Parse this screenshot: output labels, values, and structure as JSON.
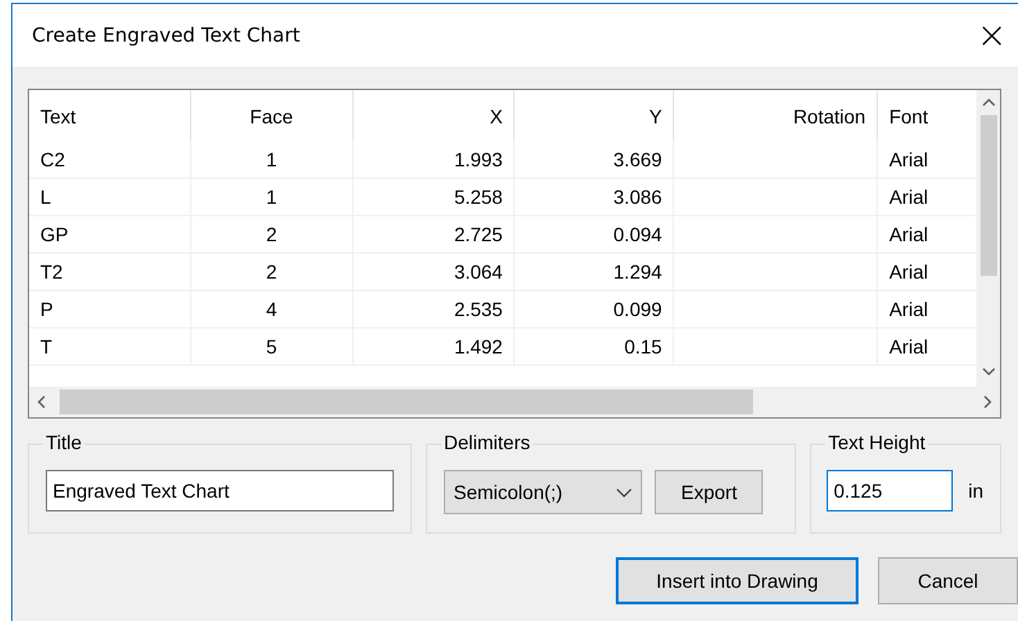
{
  "window": {
    "title": "Create Engraved Text Chart",
    "close": "×"
  },
  "table": {
    "columns": [
      "Text",
      "Face",
      "X",
      "Y",
      "Rotation",
      "Font"
    ],
    "rows": [
      [
        "C2",
        "1",
        "1.993",
        "3.669",
        "",
        "Arial"
      ],
      [
        "L",
        "1",
        "5.258",
        "3.086",
        "",
        "Arial"
      ],
      [
        "GP",
        "2",
        "2.725",
        "0.094",
        "",
        "Arial"
      ],
      [
        "T2",
        "2",
        "3.064",
        "1.294",
        "",
        "Arial"
      ],
      [
        "P",
        "4",
        "2.535",
        "0.099",
        "",
        "Arial"
      ],
      [
        "T",
        "5",
        "1.492",
        "0.15",
        "",
        "Arial"
      ]
    ]
  },
  "title_group": {
    "label": "Title",
    "value": "Engraved Text Chart"
  },
  "delimiters_group": {
    "label": "Delimiters",
    "selected_option": "Semicolon(;)",
    "export_button": "Export"
  },
  "text_height_group": {
    "label": "Text Height",
    "value": "0.125",
    "unit": "in",
    "focused": true
  },
  "buttons": [
    {
      "label": "Insert into Drawing",
      "default": true
    },
    {
      "label": "Cancel",
      "default": false
    }
  ]
}
